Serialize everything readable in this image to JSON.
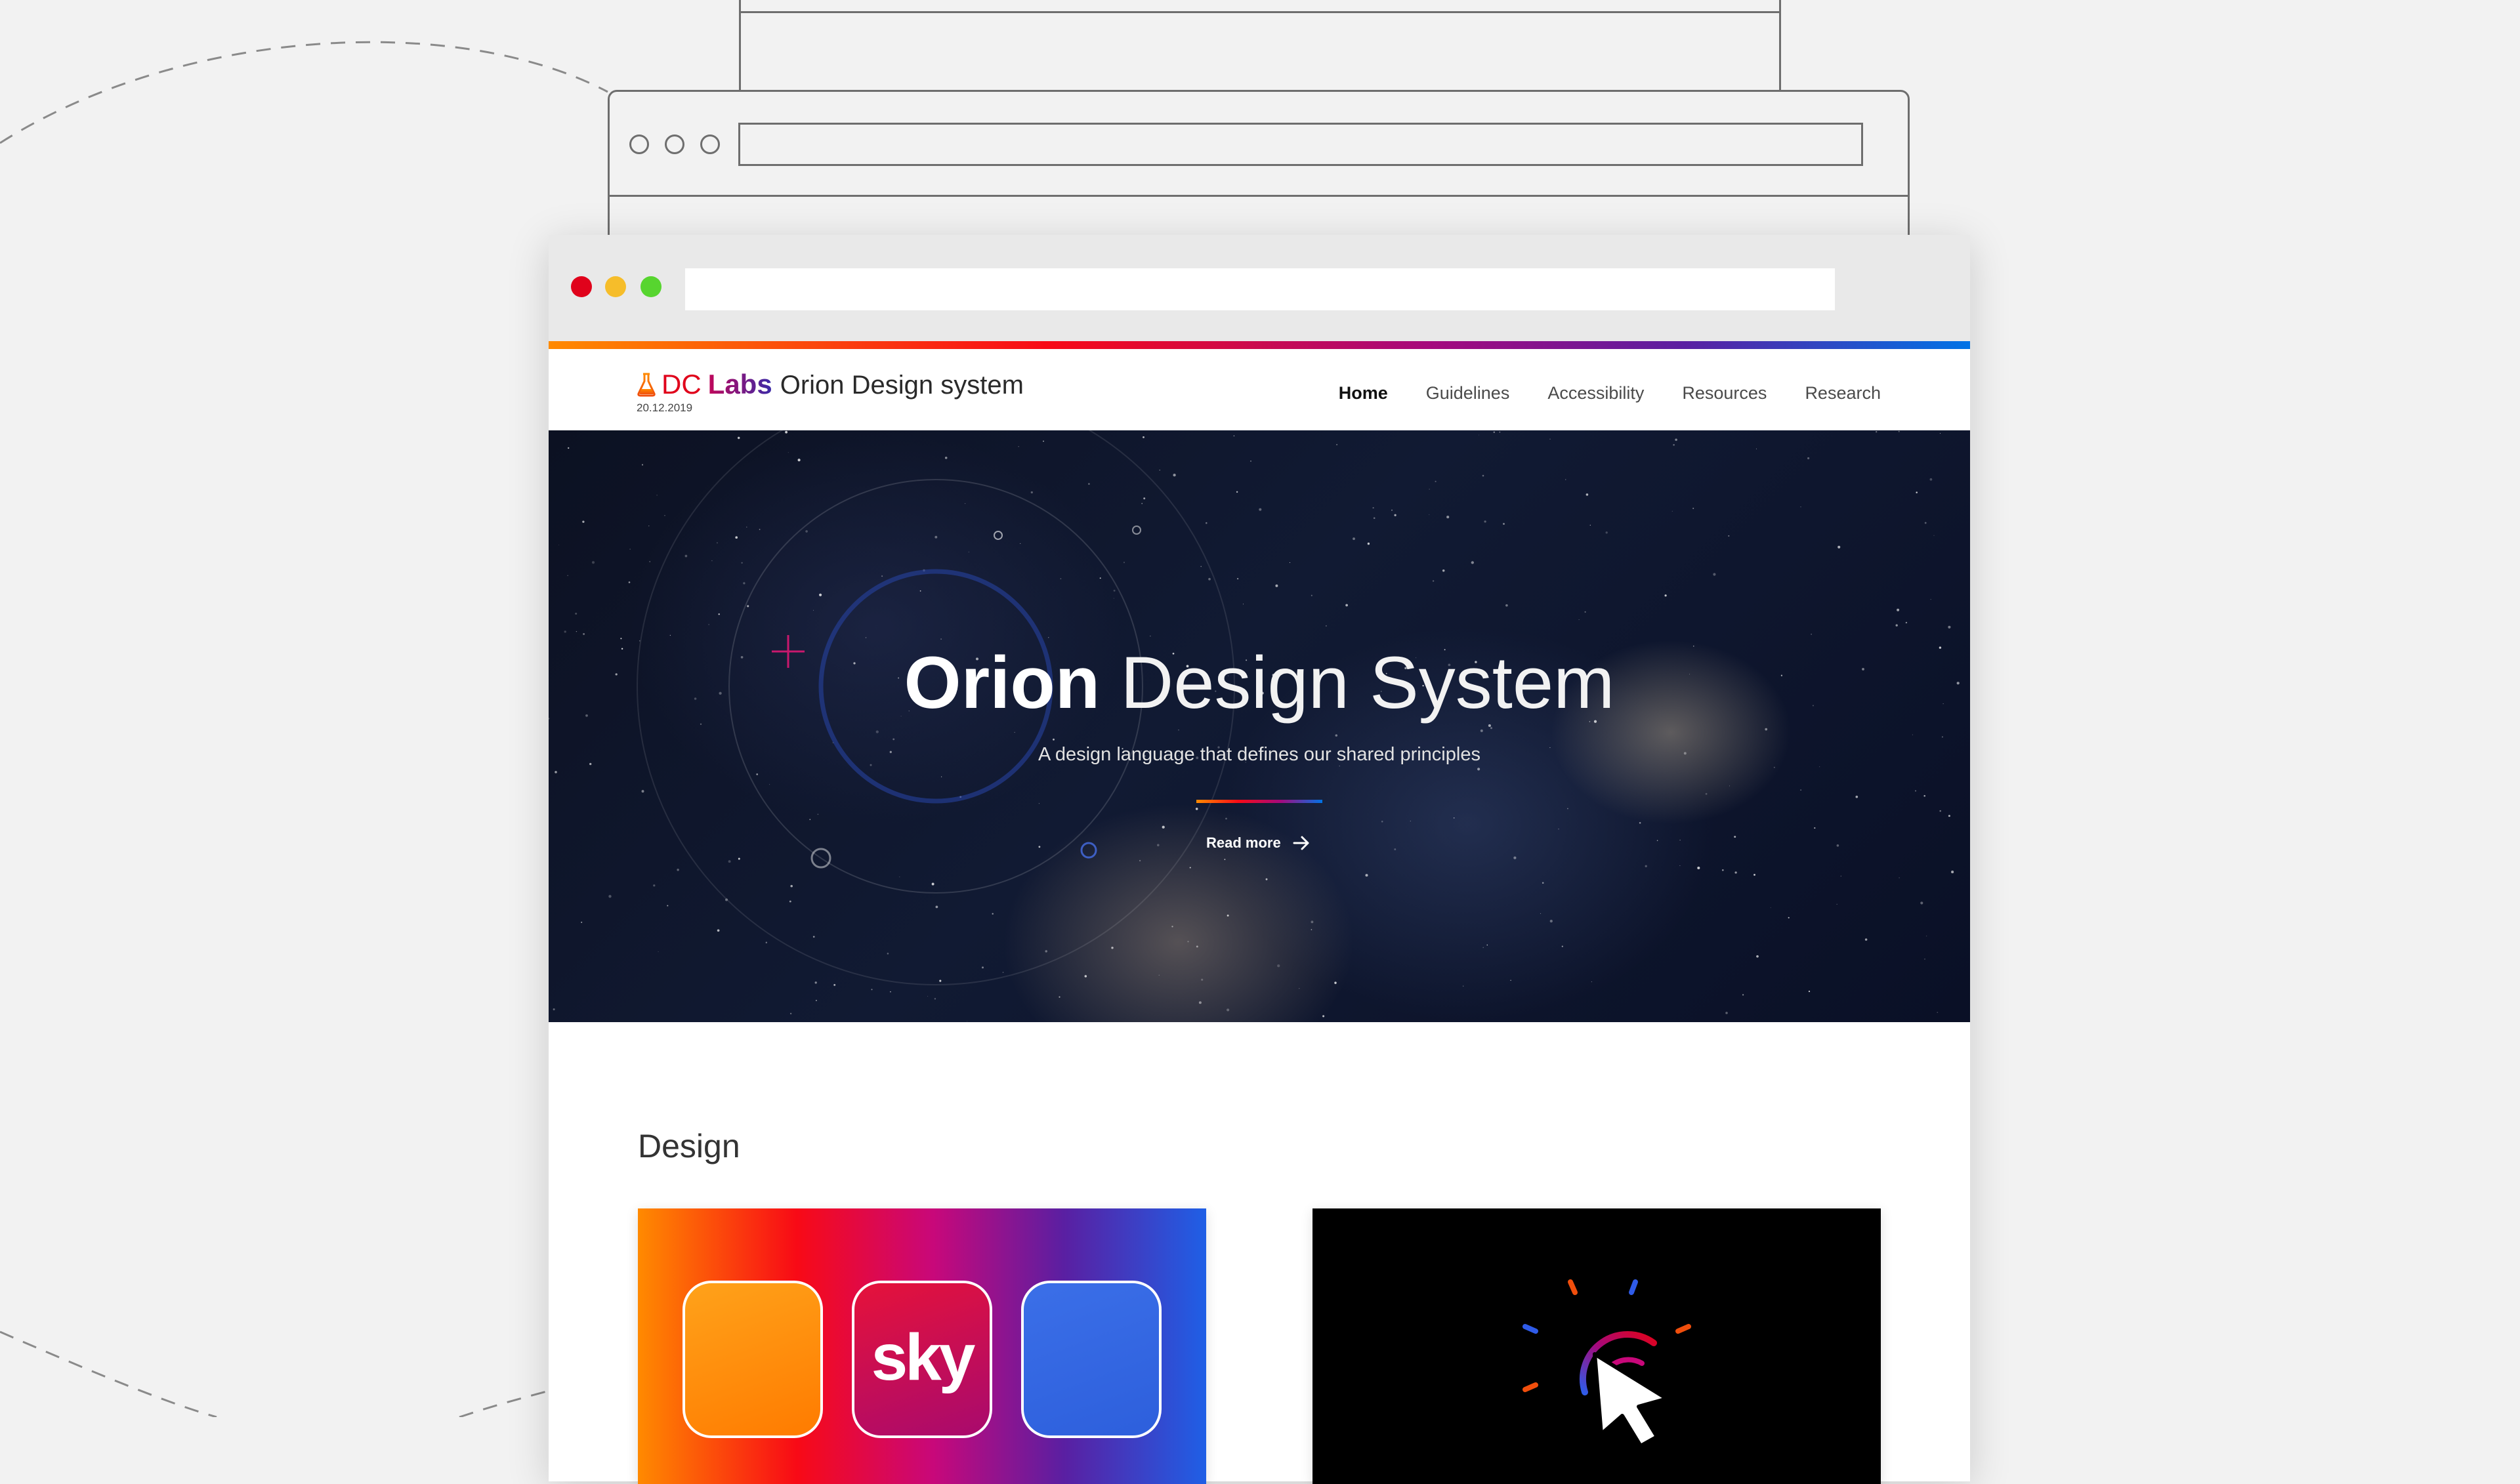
{
  "header": {
    "brand_dc": "DC",
    "brand_labs": "Labs",
    "brand_title": "Orion Design system",
    "date": "20.12.2019"
  },
  "nav": {
    "items": [
      {
        "label": "Home",
        "active": true
      },
      {
        "label": "Guidelines",
        "active": false
      },
      {
        "label": "Accessibility",
        "active": false
      },
      {
        "label": "Resources",
        "active": false
      },
      {
        "label": "Research",
        "active": false
      }
    ]
  },
  "hero": {
    "title_bold": "Orion",
    "title_rest": "Design System",
    "subtitle": "A design language that defines our shared principles",
    "cta_label": "Read more"
  },
  "main": {
    "section_title": "Design",
    "cards": [
      {
        "tile_text": "sky"
      }
    ]
  },
  "colors": {
    "brand_gradient": [
      "#ff8a00",
      "#f80a16",
      "#a5097d",
      "#0073e6"
    ],
    "traffic_lights": [
      "#e0021b",
      "#f6bd2a",
      "#57d52f"
    ]
  }
}
